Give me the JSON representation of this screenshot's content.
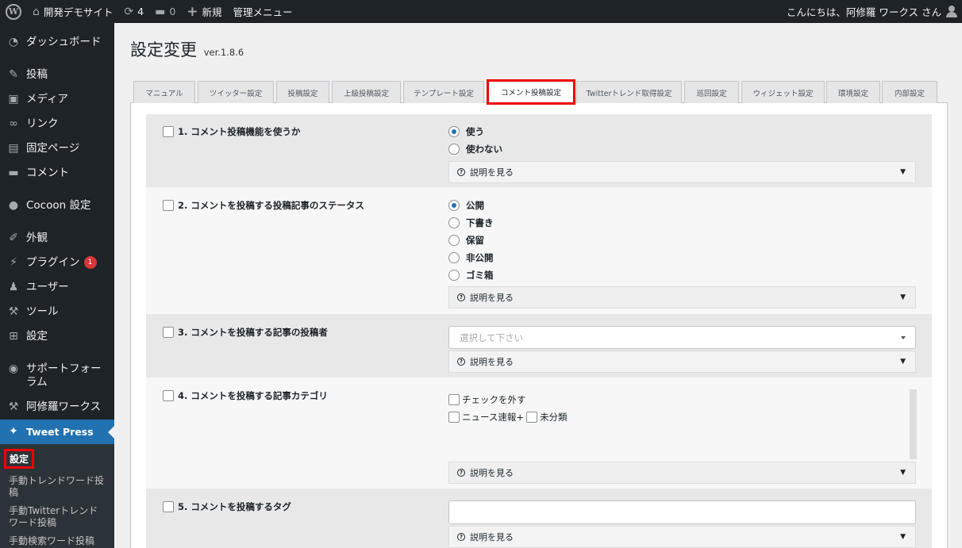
{
  "adminbar": {
    "site_name": "開発デモサイト",
    "updates_count": "4",
    "comments_count": "0",
    "new_label": "新規",
    "admin_menu_label": "管理メニュー",
    "greeting": "こんにちは、阿修羅 ワークス さん"
  },
  "sidebar": {
    "items": [
      {
        "label": "ダッシュボード",
        "icon": "dashboard-icon"
      },
      {
        "label": "投稿",
        "icon": "pin-icon"
      },
      {
        "label": "メディア",
        "icon": "media-icon"
      },
      {
        "label": "リンク",
        "icon": "link-icon"
      },
      {
        "label": "固定ページ",
        "icon": "pages-icon"
      },
      {
        "label": "コメント",
        "icon": "comment-icon"
      },
      {
        "label": "Cocoon 設定",
        "icon": "cocoon-icon"
      },
      {
        "label": "外観",
        "icon": "appearance-icon"
      },
      {
        "label": "プラグイン",
        "icon": "plugin-icon",
        "badge": "1"
      },
      {
        "label": "ユーザー",
        "icon": "user-icon"
      },
      {
        "label": "ツール",
        "icon": "tool-icon"
      },
      {
        "label": "設定",
        "icon": "settings-icon"
      },
      {
        "label": "サポートフォーラム",
        "icon": "support-icon"
      },
      {
        "label": "阿修羅ワークス",
        "icon": "wrench-icon"
      },
      {
        "label": "Tweet Press",
        "icon": "twitter-icon"
      }
    ],
    "submenu": [
      {
        "label": "設定"
      },
      {
        "label": "手動トレンドワード投稿"
      },
      {
        "label": "手動Twitterトレンドワード投稿"
      },
      {
        "label": "手動検索ワード投稿"
      }
    ]
  },
  "page": {
    "title": "設定変更",
    "version": "ver.1.8.6"
  },
  "tabs": [
    "マニュアル",
    "ツイッター設定",
    "投稿設定",
    "上級投稿設定",
    "テンプレート設定",
    "コメント投稿設定",
    "Twitterトレンド取得設定",
    "巡回設定",
    "ウィジェット設定",
    "環境設定",
    "内部設定"
  ],
  "explain_label": "説明を見る",
  "options": {
    "o1": {
      "label": "1. コメント投稿機能を使うか",
      "radios": [
        "使う",
        "使わない"
      ],
      "selected": "使う"
    },
    "o2": {
      "label": "2. コメントを投稿する投稿記事のステータス",
      "radios": [
        "公開",
        "下書き",
        "保留",
        "非公開",
        "ゴミ箱"
      ],
      "selected": "公開"
    },
    "o3": {
      "label": "3. コメントを投稿する記事の投稿者",
      "placeholder": "選択して下さい"
    },
    "o4": {
      "label": "4. コメントを投稿する記事カテゴリ",
      "uncheck_label": "チェックを外す",
      "cat1": "ニュース速報+",
      "cat2": "未分類"
    },
    "o5": {
      "label": "5. コメントを投稿するタグ"
    }
  },
  "colors": {
    "adminbar_bg": "#1d2327",
    "accent": "#2271b1",
    "highlight_border": "#ee0000",
    "badge": "#d63638"
  }
}
